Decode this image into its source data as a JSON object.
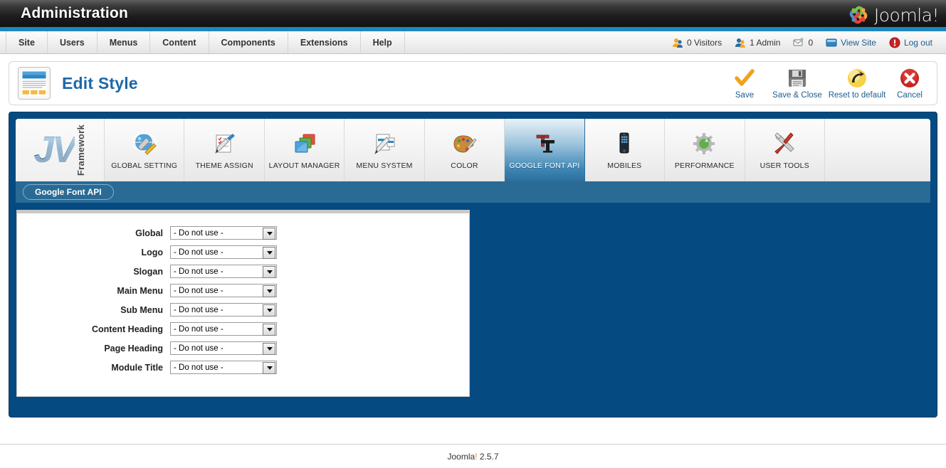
{
  "header": {
    "admin_title": "Administration",
    "brand_name": "Joomla!",
    "accent_cyan": "#1f87be"
  },
  "menubar": {
    "items": [
      {
        "label": "Site",
        "name": "menu-site"
      },
      {
        "label": "Users",
        "name": "menu-users"
      },
      {
        "label": "Menus",
        "name": "menu-menus"
      },
      {
        "label": "Content",
        "name": "menu-content"
      },
      {
        "label": "Components",
        "name": "menu-components"
      },
      {
        "label": "Extensions",
        "name": "menu-extensions"
      },
      {
        "label": "Help",
        "name": "menu-help"
      }
    ],
    "status": [
      {
        "label": "0 Visitors",
        "icon": "visitors-icon",
        "link": false
      },
      {
        "label": "1 Admin",
        "icon": "admin-user-icon",
        "link": false
      },
      {
        "label": "0",
        "icon": "messages-icon",
        "link": false
      },
      {
        "label": "View Site",
        "icon": "view-site-icon",
        "link": true
      },
      {
        "label": "Log out",
        "icon": "logout-icon",
        "link": true
      }
    ]
  },
  "page": {
    "title": "Edit Style",
    "icon": "template-preview-icon"
  },
  "toolbar": {
    "buttons": [
      {
        "label": "Save",
        "icon": "checkmark-icon",
        "name": "save-button"
      },
      {
        "label": "Save & Close",
        "icon": "floppy-disk-icon",
        "name": "save-and-close-button"
      },
      {
        "label": "Reset to default",
        "icon": "reset-arrow-icon",
        "name": "reset-to-default-button"
      },
      {
        "label": "Cancel",
        "icon": "red-x-icon",
        "name": "cancel-button"
      }
    ]
  },
  "framework": {
    "logo_text": "JV",
    "logo_subtext": "Framework",
    "tabs": [
      {
        "label": "GLOBAL SETTING",
        "icon": "globe-wrench-icon",
        "active": false
      },
      {
        "label": "THEME ASSIGN",
        "icon": "checklist-pen-icon",
        "active": false
      },
      {
        "label": "LAYOUT MANAGER",
        "icon": "stacked-windows-icon",
        "active": false
      },
      {
        "label": "MENU SYSTEM",
        "icon": "menu-pencil-icon",
        "active": false
      },
      {
        "label": "COLOR",
        "icon": "palette-brush-icon",
        "active": false
      },
      {
        "label": "GOOGLE FONT API",
        "icon": "typography-tt-icon",
        "active": true
      },
      {
        "label": "MOBILES",
        "icon": "smartphone-icon",
        "active": false
      },
      {
        "label": "PERFORMANCE",
        "icon": "gear-refresh-icon",
        "active": false
      },
      {
        "label": "USER TOOLS",
        "icon": "wrench-screwdriver-icon",
        "active": false
      }
    ],
    "subtabs": [
      {
        "label": "Google Font API",
        "active": true
      }
    ]
  },
  "form": {
    "default_option": "- Do not use -",
    "options": [
      "- Do not use -"
    ],
    "rows": [
      {
        "label": "Global",
        "value": "- Do not use -",
        "name": "field-global"
      },
      {
        "label": "Logo",
        "value": "- Do not use -",
        "name": "field-logo"
      },
      {
        "label": "Slogan",
        "value": "- Do not use -",
        "name": "field-slogan"
      },
      {
        "label": "Main Menu",
        "value": "- Do not use -",
        "name": "field-main-menu"
      },
      {
        "label": "Sub Menu",
        "value": "- Do not use -",
        "name": "field-sub-menu"
      },
      {
        "label": "Content Heading",
        "value": "- Do not use -",
        "name": "field-content-heading"
      },
      {
        "label": "Page Heading",
        "value": "- Do not use -",
        "name": "field-page-heading"
      },
      {
        "label": "Module Title",
        "value": "- Do not use -",
        "name": "field-module-title"
      }
    ]
  },
  "footer": {
    "product": "Joomla",
    "bang": "!",
    "version": " 2.5.7"
  },
  "colors": {
    "panel_blue": "#054a80",
    "subtab_blue": "#2a6b96",
    "title_blue": "#1c68a8",
    "link_blue": "#1c5d8f",
    "accent_orange": "#f08a24"
  }
}
